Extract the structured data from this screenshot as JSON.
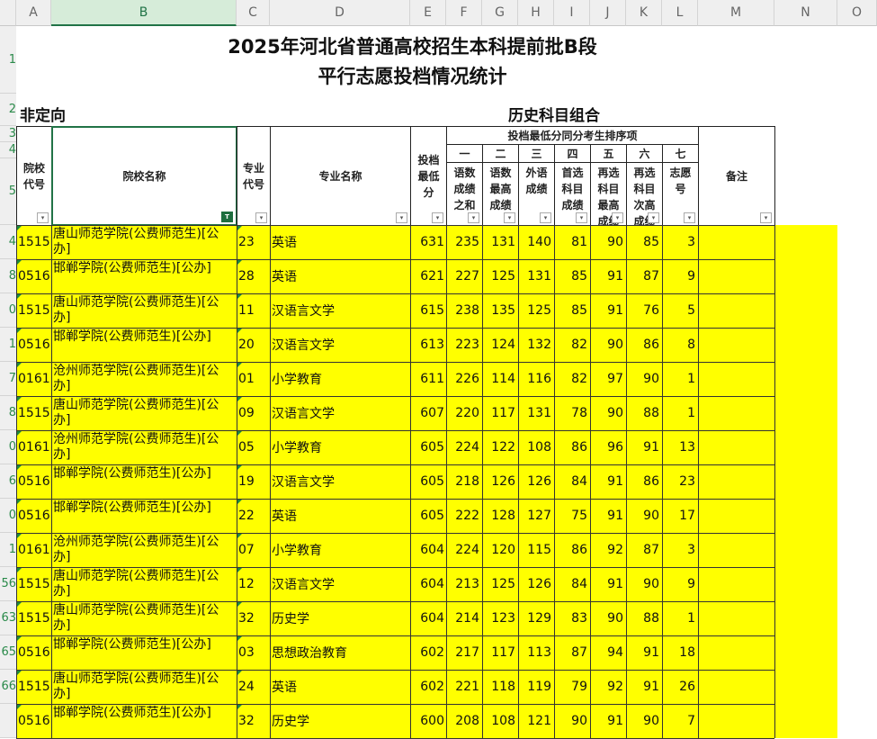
{
  "columns": [
    "A",
    "B",
    "C",
    "D",
    "E",
    "F",
    "G",
    "H",
    "I",
    "J",
    "K",
    "L",
    "M",
    "N",
    "O"
  ],
  "row_labels": [
    "1",
    "2",
    "3",
    "4",
    "5"
  ],
  "title_line1": "2025年河北省普通高校招生本科提前批B段",
  "title_line2": "平行志愿投档情况统计",
  "subtitle_left": "非定向",
  "subtitle_right": "历史科目组合",
  "headers": {
    "school_code": "院校代号",
    "school_name": "院校名称",
    "major_code": "专业代号",
    "major_name": "专业名称",
    "min_score": "投档最低分",
    "tiebreak_title": "投档最低分同分考生排序项",
    "tb_nums": [
      "一",
      "二",
      "三",
      "四",
      "五",
      "六",
      "七"
    ],
    "tb_labels": [
      "语数成绩之和",
      "语数最高成绩",
      "外语成绩",
      "首选科目成绩",
      "再选科目最高成绩",
      "再选科目次高成绩",
      "志愿号"
    ],
    "remark": "备注"
  },
  "rows": [
    {
      "rn": "4",
      "code": "1515",
      "school": "唐山师范学院(公费师范生)[公办]",
      "mc": "23",
      "major": "英语",
      "score": "631",
      "v": [
        "235",
        "131",
        "140",
        "81",
        "90",
        "85",
        "3"
      ]
    },
    {
      "rn": "8",
      "code": "0516",
      "school": "邯郸学院(公费师范生)[公办]",
      "mc": "28",
      "major": "英语",
      "score": "621",
      "v": [
        "227",
        "125",
        "131",
        "85",
        "91",
        "87",
        "9"
      ]
    },
    {
      "rn": "0",
      "code": "1515",
      "school": "唐山师范学院(公费师范生)[公办]",
      "mc": "11",
      "major": "汉语言文学",
      "score": "615",
      "v": [
        "238",
        "135",
        "125",
        "85",
        "91",
        "76",
        "5"
      ]
    },
    {
      "rn": "1",
      "code": "0516",
      "school": "邯郸学院(公费师范生)[公办]",
      "mc": "20",
      "major": "汉语言文学",
      "score": "613",
      "v": [
        "223",
        "124",
        "132",
        "82",
        "90",
        "86",
        "8"
      ]
    },
    {
      "rn": "7",
      "code": "0161",
      "school": "沧州师范学院(公费师范生)[公办]",
      "mc": "01",
      "major": "小学教育",
      "score": "611",
      "v": [
        "226",
        "114",
        "116",
        "82",
        "97",
        "90",
        "1"
      ]
    },
    {
      "rn": "8",
      "code": "1515",
      "school": "唐山师范学院(公费师范生)[公办]",
      "mc": "09",
      "major": "汉语言文学",
      "score": "607",
      "v": [
        "220",
        "117",
        "131",
        "78",
        "90",
        "88",
        "1"
      ]
    },
    {
      "rn": "0",
      "code": "0161",
      "school": "沧州师范学院(公费师范生)[公办]",
      "mc": "05",
      "major": "小学教育",
      "score": "605",
      "v": [
        "224",
        "122",
        "108",
        "86",
        "96",
        "91",
        "13"
      ]
    },
    {
      "rn": "6",
      "code": "0516",
      "school": "邯郸学院(公费师范生)[公办]",
      "mc": "19",
      "major": "汉语言文学",
      "score": "605",
      "v": [
        "218",
        "126",
        "126",
        "84",
        "91",
        "86",
        "23"
      ]
    },
    {
      "rn": "0",
      "code": "0516",
      "school": "邯郸学院(公费师范生)[公办]",
      "mc": "22",
      "major": "英语",
      "score": "605",
      "v": [
        "222",
        "128",
        "127",
        "75",
        "91",
        "90",
        "17"
      ]
    },
    {
      "rn": "1",
      "code": "0161",
      "school": "沧州师范学院(公费师范生)[公办]",
      "mc": "07",
      "major": "小学教育",
      "score": "604",
      "v": [
        "224",
        "120",
        "115",
        "86",
        "92",
        "87",
        "3"
      ]
    },
    {
      "rn": "56",
      "code": "1515",
      "school": "唐山师范学院(公费师范生)[公办]",
      "mc": "12",
      "major": "汉语言文学",
      "score": "604",
      "v": [
        "213",
        "125",
        "126",
        "84",
        "91",
        "90",
        "9"
      ]
    },
    {
      "rn": "63",
      "code": "1515",
      "school": "唐山师范学院(公费师范生)[公办]",
      "mc": "32",
      "major": "历史学",
      "score": "604",
      "v": [
        "214",
        "123",
        "129",
        "83",
        "90",
        "88",
        "1"
      ]
    },
    {
      "rn": "65",
      "code": "0516",
      "school": "邯郸学院(公费师范生)[公办]",
      "mc": "03",
      "major": "思想政治教育",
      "score": "602",
      "v": [
        "217",
        "117",
        "113",
        "87",
        "94",
        "91",
        "18"
      ]
    },
    {
      "rn": "66",
      "code": "1515",
      "school": "唐山师范学院(公费师范生)[公办]",
      "mc": "24",
      "major": "英语",
      "score": "602",
      "v": [
        "221",
        "118",
        "119",
        "79",
        "92",
        "91",
        "26"
      ]
    },
    {
      "rn": "",
      "code": "0516",
      "school": "邯郸学院(公费师范生)[公办]",
      "mc": "32",
      "major": "历史学",
      "score": "600",
      "v": [
        "208",
        "108",
        "121",
        "90",
        "91",
        "90",
        "7"
      ]
    }
  ]
}
